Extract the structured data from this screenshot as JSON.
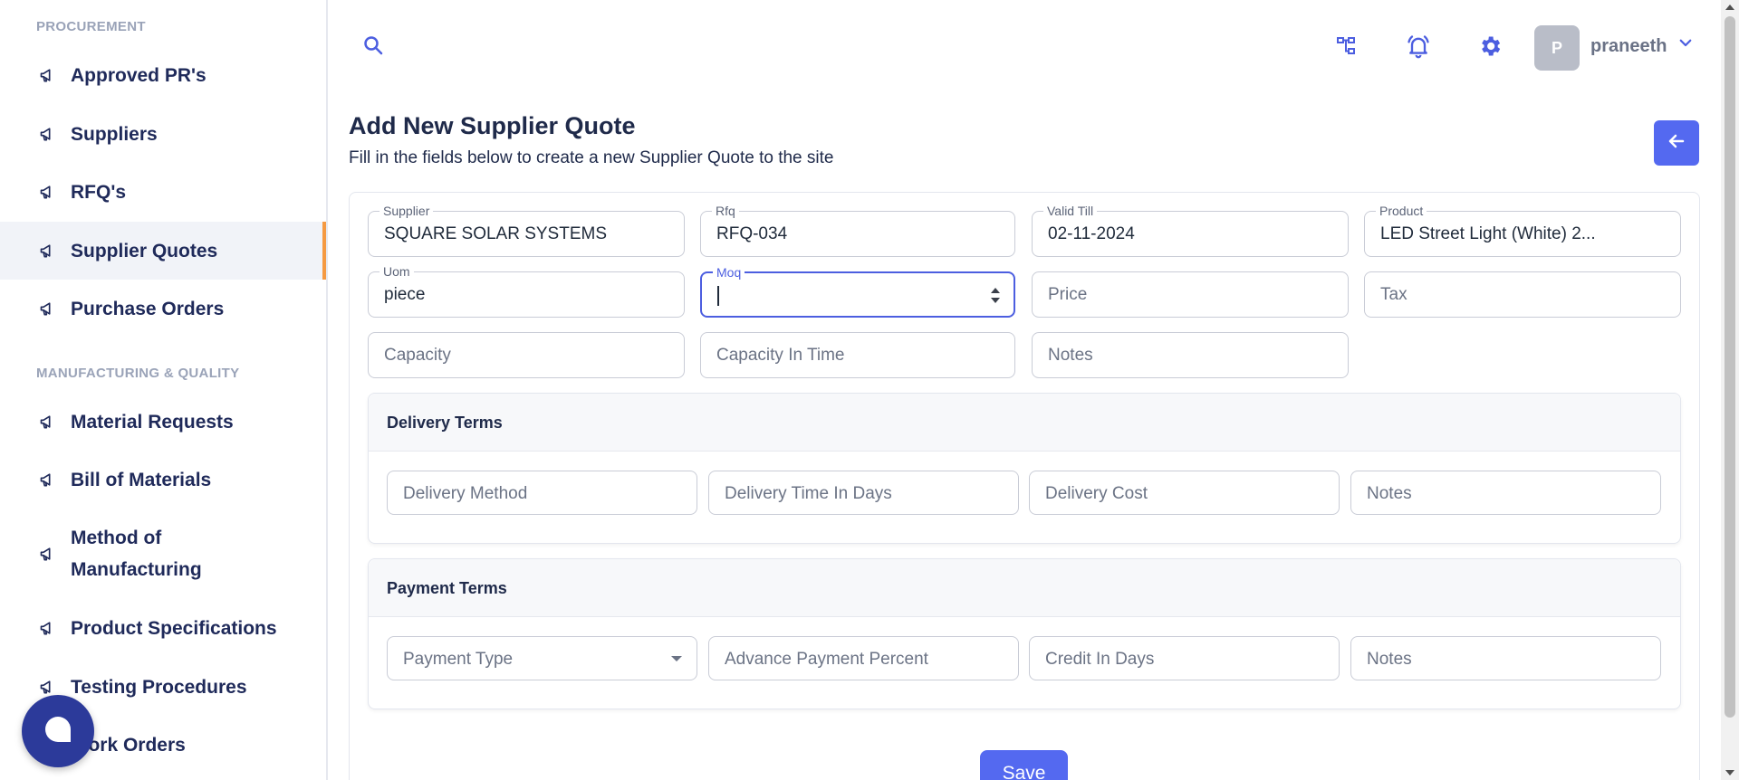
{
  "sidebar": {
    "sections": [
      {
        "title": "PROCUREMENT"
      },
      {
        "title": "MANUFACTURING & QUALITY"
      }
    ],
    "items": [
      {
        "label": "Approved PR's"
      },
      {
        "label": "Suppliers"
      },
      {
        "label": "RFQ's"
      },
      {
        "label": "Supplier Quotes"
      },
      {
        "label": "Purchase Orders"
      },
      {
        "label": "Material Requests"
      },
      {
        "label": "Bill of Materials"
      },
      {
        "label": "Method of Manufacturing"
      },
      {
        "label": "Product Specifications"
      },
      {
        "label": "Testing Procedures"
      },
      {
        "label": "Work Orders"
      }
    ],
    "active_item": "Supplier Quotes"
  },
  "header": {
    "user": {
      "initial": "P",
      "name": "praneeth"
    },
    "icons": [
      "search-icon",
      "org-chart-icon",
      "bell-icon",
      "gear-icon",
      "chevron-down-icon"
    ]
  },
  "page": {
    "title": "Add New Supplier Quote",
    "subtitle": "Fill in the fields below to create a new Supplier Quote to the site"
  },
  "form": {
    "supplier": {
      "label": "Supplier",
      "value": "SQUARE SOLAR SYSTEMS"
    },
    "rfq": {
      "label": "Rfq",
      "value": "RFQ-034"
    },
    "valid_till": {
      "label": "Valid Till",
      "value": "02-11-2024"
    },
    "product": {
      "label": "Product",
      "value": "LED Street Light (White) 2..."
    },
    "uom": {
      "label": "Uom",
      "value": "piece"
    },
    "moq": {
      "label": "Moq",
      "value": ""
    },
    "price": {
      "placeholder": "Price"
    },
    "tax": {
      "placeholder": "Tax"
    },
    "capacity": {
      "placeholder": "Capacity"
    },
    "capacity_in_time": {
      "placeholder": "Capacity In Time"
    },
    "notes": {
      "placeholder": "Notes"
    }
  },
  "delivery_terms": {
    "title": "Delivery Terms",
    "fields": {
      "method": "Delivery Method",
      "time_in_days": "Delivery Time In Days",
      "cost": "Delivery Cost",
      "notes": "Notes"
    }
  },
  "payment_terms": {
    "title": "Payment Terms",
    "fields": {
      "type": "Payment Type",
      "advance_percent": "Advance Payment Percent",
      "credit_in_days": "Credit In Days",
      "notes": "Notes"
    }
  },
  "actions": {
    "save": "Save"
  },
  "colors": {
    "accent": "#5469f0",
    "nav_text": "#1f2a5a",
    "active_marker": "#f59a42",
    "chat_bubble": "#2c3a9a"
  }
}
